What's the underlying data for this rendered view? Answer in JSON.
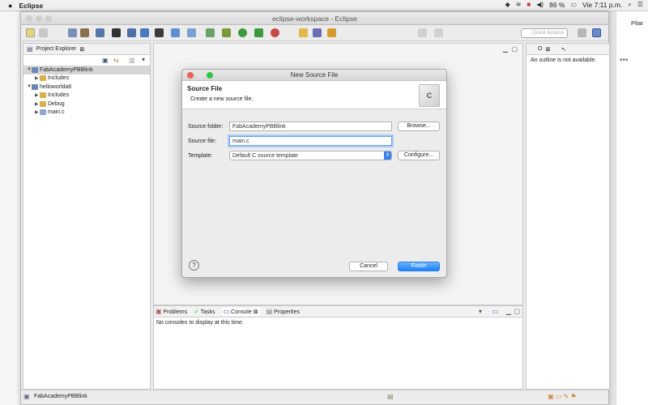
{
  "menubar": {
    "app": "Eclipse",
    "battery": "86 %",
    "clock": "Vie 7:11 p.m."
  },
  "window": {
    "title": "eclipse-workspace - Eclipse"
  },
  "toolbar": {
    "quick_access_placeholder": "Quick Access"
  },
  "project_explorer": {
    "title": "Project Explorer",
    "tree": [
      {
        "label": "FabAcademyPBBlink",
        "level": 0,
        "expanded": true,
        "selected": true
      },
      {
        "label": "Includes",
        "level": 1
      },
      {
        "label": "helloworlda6",
        "level": 0,
        "expanded": true
      },
      {
        "label": "Includes",
        "level": 1
      },
      {
        "label": "Debug",
        "level": 1
      },
      {
        "label": "main.c",
        "level": 1
      }
    ]
  },
  "outline": {
    "tab_label": "O",
    "message": "An outline is not available."
  },
  "console": {
    "tabs": [
      "Problems",
      "Tasks",
      "Console",
      "Properties"
    ],
    "message": "No consoles to display at this time."
  },
  "statusbar": {
    "text": "FabAcademyPBBlink"
  },
  "dialog": {
    "title": "New Source File",
    "header_title": "Source File",
    "header_desc": "Create a new source file.",
    "source_folder_label": "Source folder:",
    "source_folder_value": "FabAcademyPBBlink",
    "source_file_label": "Source file:",
    "source_file_value": "main.c",
    "template_label": "Template:",
    "template_value": "Default C source template",
    "browse": "Browse...",
    "configure": "Configure...",
    "cancel": "Cancel",
    "finish": "Finish",
    "help_icon": "?"
  },
  "right_partial": {
    "name": "Pilar"
  }
}
